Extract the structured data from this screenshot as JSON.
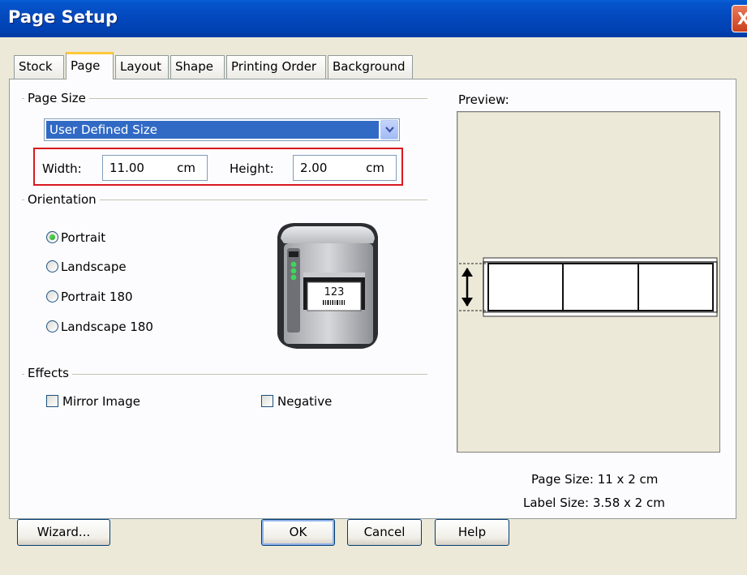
{
  "window": {
    "title": "Page Setup",
    "close_glyph": "X"
  },
  "tabs": [
    {
      "label": "Stock",
      "active": false
    },
    {
      "label": "Page",
      "active": true
    },
    {
      "label": "Layout",
      "active": false
    },
    {
      "label": "Shape",
      "active": false
    },
    {
      "label": "Printing Order",
      "active": false
    },
    {
      "label": "Background",
      "active": false
    }
  ],
  "page_size": {
    "section_label": "Page Size",
    "selected": "User Defined Size",
    "width_label": "Width:",
    "width_value": "11.00",
    "width_unit": "cm",
    "height_label": "Height:",
    "height_value": "2.00",
    "height_unit": "cm"
  },
  "orientation": {
    "section_label": "Orientation",
    "options": [
      {
        "label": "Portrait",
        "checked": true
      },
      {
        "label": "Landscape",
        "checked": false
      },
      {
        "label": "Portrait 180",
        "checked": false
      },
      {
        "label": "Landscape 180",
        "checked": false
      }
    ],
    "printer_label_text": "123"
  },
  "effects": {
    "section_label": "Effects",
    "mirror_image": {
      "label": "Mirror Image",
      "checked": false
    },
    "negative": {
      "label": "Negative",
      "checked": false
    }
  },
  "preview": {
    "label": "Preview:",
    "page_size_text": "Page Size:  11 x 2 cm",
    "label_size_text": "Label Size:  3.58 x 2 cm",
    "labels_across": 3
  },
  "buttons": {
    "wizard": "Wizard...",
    "ok": "OK",
    "cancel": "Cancel",
    "help": "Help"
  },
  "colors": {
    "titlebar": "#0348bd",
    "selection": "#316ac5",
    "highlight_border": "#d9181f",
    "tab_active_accent": "#ffc83c",
    "radio_dot": "#21a121"
  }
}
